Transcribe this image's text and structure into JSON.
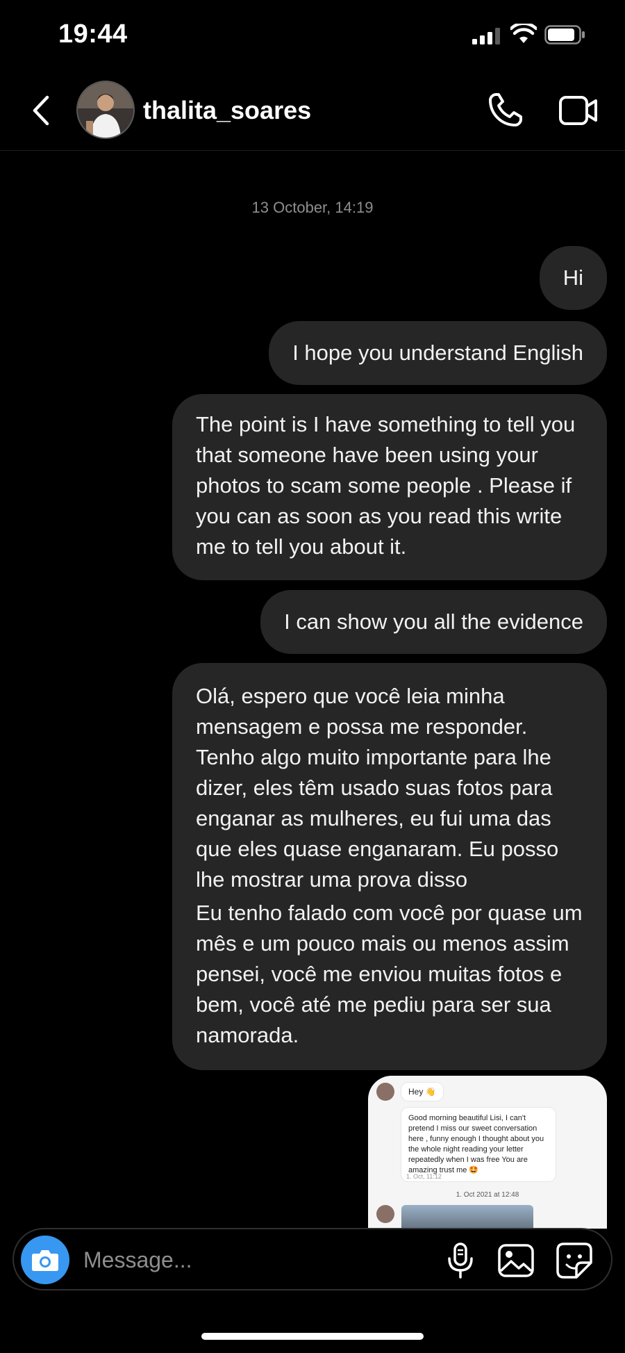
{
  "status_bar": {
    "time": "19:44"
  },
  "header": {
    "username": "thalita_soares"
  },
  "thread": {
    "timestamp": "13 October, 14:19",
    "messages": [
      {
        "text": "Hi"
      },
      {
        "text": "I hope you understand English"
      },
      {
        "text": "The point is I have something to tell you that someone have been using your photos to scam some people . Please if you can as soon as you read this write me to tell you about it."
      },
      {
        "text": "I can show you all the evidence"
      },
      {
        "paragraph1": "Olá, espero que você leia minha mensagem e possa me responder. Tenho algo muito importante para lhe dizer, eles têm usado suas fotos para enganar as mulheres, eu fui uma das que eles quase enganaram. Eu posso lhe mostrar uma prova disso",
        "paragraph2": "Eu tenho falado com você por quase um mês e um pouco mais ou menos assim pensei, você me enviou muitas fotos e bem, você até me pediu para ser sua namorada."
      }
    ],
    "shared_image": {
      "hey_text": "Hey 👋",
      "message_text": "Good morning beautiful Lisi, I can't pretend I miss our sweet conversation here , funny enough I thought about you the whole night reading your letter repeatedly when I was free You are amazing trust me 🤩",
      "meta": "1. Oct, 11:12",
      "date": "1. Oct 2021 at 12:48"
    }
  },
  "composer": {
    "placeholder": "Message..."
  },
  "colors": {
    "camera_button": "#3897f0",
    "bubble": "#262626",
    "timestamp": "#8e8e8e"
  }
}
